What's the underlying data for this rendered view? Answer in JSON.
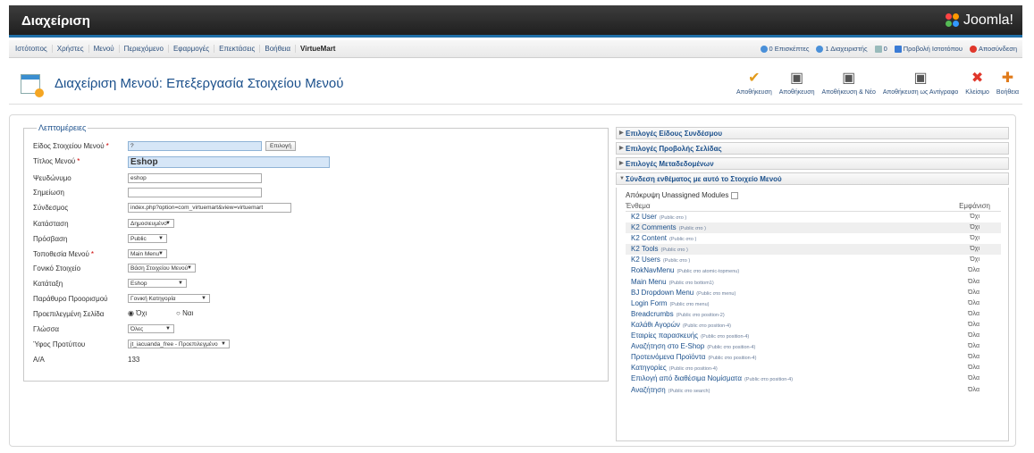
{
  "header": {
    "title": "Διαχείριση",
    "logo_text": "Joomla!"
  },
  "menu": [
    "Ιστότοπος",
    "Χρήστες",
    "Μενού",
    "Περιεχόμενο",
    "Εφαρμογές",
    "Επεκτάσεις",
    "Βοήθεια",
    "VirtueMart"
  ],
  "status": {
    "visitors": "0 Επισκέπτες",
    "admins": "1 Διαχειριστής",
    "messages": "0",
    "preview": "Προβολή Ιστοτόπου",
    "logout": "Αποσύνδεση"
  },
  "toolbar": {
    "page_title": "Διαχείριση Μενού: Επεξεργασία Στοιχείου Μενού",
    "actions": [
      "Αποθήκευση",
      "Αποθήκευση",
      "Αποθήκευση & Νέο",
      "Αποθήκευση ως Αντίγραφο",
      "Κλείσιμο",
      "Βοήθεια"
    ]
  },
  "details": {
    "legend": "Λεπτομέρειες",
    "fields": [
      {
        "label": "Είδος Στοιχείου Μενού",
        "required": true,
        "value": "?",
        "button": "Επιλογή"
      },
      {
        "label": "Τίτλος Μενού",
        "required": true,
        "value": "Eshop"
      },
      {
        "label": "Ψευδώνυμο",
        "value": "eshop"
      },
      {
        "label": "Σημείωση",
        "value": ""
      },
      {
        "label": "Σύνδεσμος",
        "value": "index.php?option=com_virtuemart&view=virtuemart"
      },
      {
        "label": "Κατάσταση",
        "value": "Δημοσιευμένο"
      },
      {
        "label": "Πρόσβαση",
        "value": "Public"
      },
      {
        "label": "Τοποθεσία Μενού",
        "required": true,
        "value": "Main Menu"
      },
      {
        "label": "Γονικό Στοιχείο",
        "value": "Βάση Στοιχείου Μενού"
      },
      {
        "label": "Κατάταξη",
        "value": "Eshop"
      },
      {
        "label": "Παράθυρο Προορισμού",
        "value": "Γονική Κατηγορία"
      },
      {
        "label": "Προεπιλεγμένη Σελίδα",
        "value_no": "Όχι",
        "value_yes": "Ναι"
      },
      {
        "label": "Γλώσσα",
        "value": "Όλες"
      },
      {
        "label": "Ύφος Προτύπου",
        "value": "jt_iacuanda_free - Προεπιλεγμένο"
      },
      {
        "label": "Α/Α",
        "value": "133"
      }
    ],
    "required_mark": "*"
  },
  "right": {
    "accordion": [
      "Επιλογές Είδους Συνδέσμου",
      "Επιλογές Προβολής Σελίδας",
      "Επιλογές Μεταδεδομένων",
      "Σύνδεση ενθέματος με αυτό το Στοιχείο Μενού"
    ],
    "hide_unassigned": "Απόκρυψη Unassigned Modules",
    "col_module": "Ένθεμα",
    "col_display": "Εμφάνιση",
    "modules": [
      {
        "name": "K2 User",
        "pos": "(Public στο )",
        "vis": "Όχι"
      },
      {
        "name": "K2 Comments",
        "pos": "(Public στο )",
        "vis": "Όχι"
      },
      {
        "name": "K2 Content",
        "pos": "(Public στο )",
        "vis": "Όχι"
      },
      {
        "name": "K2 Tools",
        "pos": "(Public στο )",
        "vis": "Όχι"
      },
      {
        "name": "K2 Users",
        "pos": "(Public στο )",
        "vis": "Όχι"
      },
      {
        "name": "RokNavMenu",
        "pos": "(Public στο atomic-topmenu)",
        "vis": "Όλα"
      },
      {
        "name": "Main Menu",
        "pos": "(Public στο bottom1)",
        "vis": "Όλα"
      },
      {
        "name": "BJ Dropdown Menu",
        "pos": "(Public στο menu)",
        "vis": "Όλα"
      },
      {
        "name": "Login Form",
        "pos": "(Public στο menu)",
        "vis": "Όλα"
      },
      {
        "name": "Breadcrumbs",
        "pos": "(Public στο position-2)",
        "vis": "Όλα"
      },
      {
        "name": "Καλάθι Αγορών",
        "pos": "(Public στο position-4)",
        "vis": "Όλα"
      },
      {
        "name": "Εταιρίες παρασκευής",
        "pos": "(Public στο position-4)",
        "vis": "Όλα"
      },
      {
        "name": "Αναζήτηση στο E-Shop",
        "pos": "(Public στο position-4)",
        "vis": "Όλα"
      },
      {
        "name": "Προτεινόμενα Προϊόντα",
        "pos": "(Public στο position-4)",
        "vis": "Όλα"
      },
      {
        "name": "Κατηγορίες",
        "pos": "(Public στο position-4)",
        "vis": "Όλα"
      },
      {
        "name": "Επιλογή από διαθέσιμα Νομίσματα",
        "pos": "(Public στο position-4)",
        "vis": "Όλα"
      },
      {
        "name": "Αναζήτηση",
        "pos": "(Public στο search)",
        "vis": "Όλα"
      }
    ]
  }
}
